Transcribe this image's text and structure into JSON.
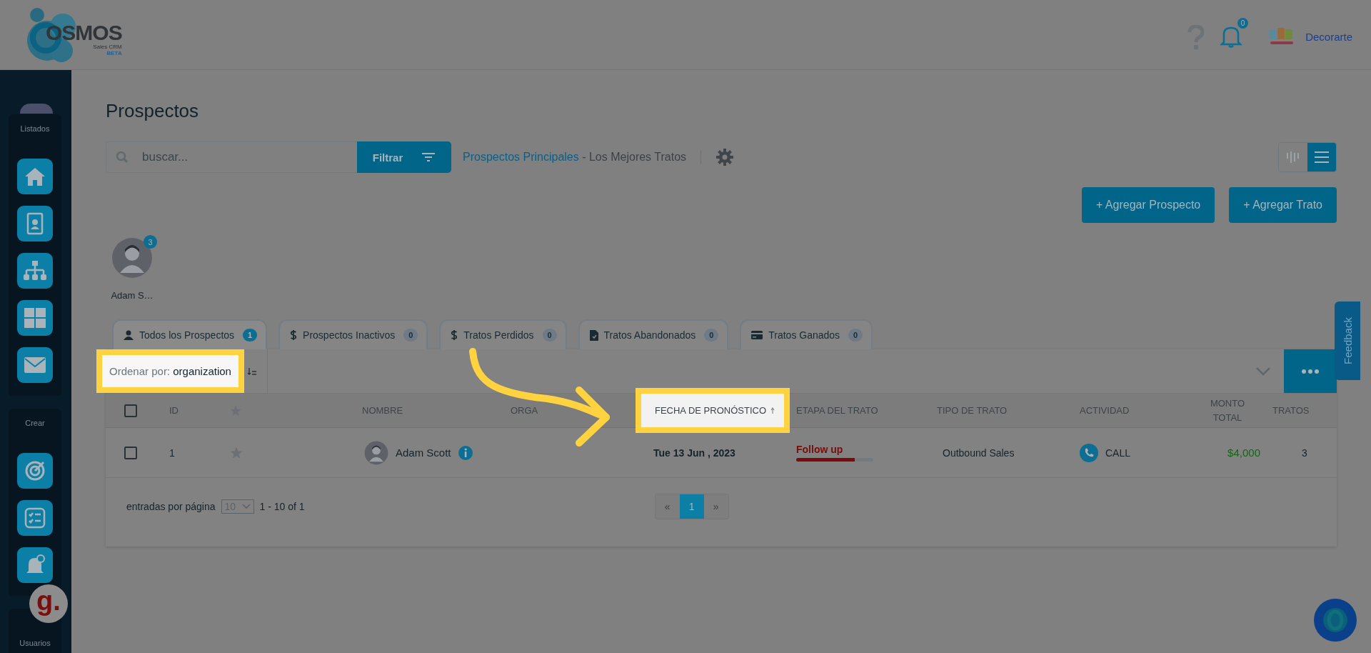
{
  "header": {
    "logo": {
      "name": "OSMOS",
      "subtitle": "Sales CRM",
      "badge": "BETA"
    },
    "notifications": "0",
    "company": "Decorarte"
  },
  "sidebar": {
    "sections": [
      {
        "label": "Listados",
        "items": [
          {
            "kind": "home"
          },
          {
            "kind": "contact"
          },
          {
            "kind": "hierarchy"
          },
          {
            "kind": "grid"
          },
          {
            "kind": "mail"
          }
        ]
      },
      {
        "label": "Crear",
        "items": [
          {
            "kind": "target"
          },
          {
            "kind": "checklist"
          },
          {
            "kind": "alarm"
          }
        ]
      }
    ],
    "footer_label": "Usuarios"
  },
  "title": "Prospectos",
  "search": {
    "placeholder": "buscar..."
  },
  "filter_button": "Filtrar",
  "pipeline": {
    "name": "Prospectos Principales",
    "suffix": "- Los Mejores Tratos"
  },
  "view_toggle": [
    {
      "kind": "kanban",
      "selected": false
    },
    {
      "kind": "list",
      "selected": true
    }
  ],
  "actions": [
    "+ Agregar Prospecto",
    "+ Agregar Trato"
  ],
  "owners": [
    {
      "name": "Adam S…",
      "count": "3"
    }
  ],
  "tabs": [
    {
      "kind": "user",
      "label": "Todos los Prospectos",
      "count": "1",
      "selected": true
    },
    {
      "kind": "dollar",
      "label": "Prospectos Inactivos",
      "count": "0",
      "selected": false
    },
    {
      "kind": "dollar",
      "label": "Tratos Perdidos",
      "count": "0",
      "selected": false
    },
    {
      "kind": "file",
      "label": "Tratos Abandonados",
      "count": "0",
      "selected": false
    },
    {
      "kind": "card",
      "label": "Tratos Ganados",
      "count": "0",
      "selected": false
    }
  ],
  "sort": {
    "label": "Ordenar por:",
    "value": "organization",
    "highlighted": true
  },
  "columns": [
    {
      "kind": "checkbox",
      "highlighted": false
    },
    {
      "kind": "text",
      "label": "ID",
      "highlighted": false
    },
    {
      "kind": "star",
      "highlighted": false
    },
    {
      "kind": "text",
      "label": "NOMBRE",
      "highlighted": false
    },
    {
      "kind": "text",
      "label": "ORGA",
      "highlighted": false
    },
    {
      "kind": "text",
      "label": "FECHA DE PRONÓSTICO",
      "highlighted": true
    },
    {
      "kind": "text",
      "label": "ETAPA DEL TRATO",
      "highlighted": false
    },
    {
      "kind": "text",
      "label": "TIPO DE TRATO",
      "highlighted": false
    },
    {
      "kind": "text",
      "label": "ACTIVIDAD",
      "highlighted": false
    },
    {
      "kind": "text",
      "label": "MONTO TOTAL",
      "highlighted": false
    },
    {
      "kind": "text",
      "label": "TRATOS",
      "highlighted": false
    }
  ],
  "rows": [
    {
      "checked": false,
      "id": "1",
      "starred": false,
      "name": "Adam Scott",
      "forecast_date": "Tue 13 Jun , 2023",
      "stage": {
        "label": "Follow up",
        "level": 0.76
      },
      "deal_type": "Outbound Sales",
      "activity": {
        "kind": "call",
        "label": "CALL"
      },
      "amount": "$4,000",
      "deals": "3"
    }
  ],
  "footer": {
    "per_page_label": "entradas por página",
    "per_page": "10",
    "range": "1 - 10 of 1",
    "prev": "«",
    "pages": [
      {
        "label": "1",
        "selected": true
      }
    ],
    "next": "»"
  },
  "feedback": "Feedback",
  "widget_label": "g."
}
